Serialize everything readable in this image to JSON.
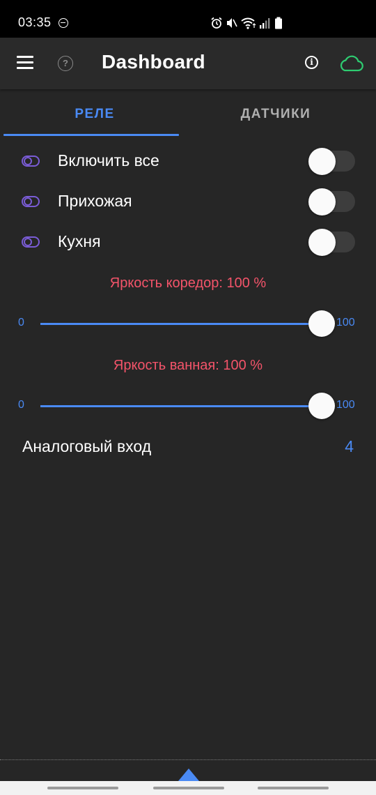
{
  "status_bar": {
    "time": "03:35",
    "icons": [
      "dnd-icon",
      "alarm-icon",
      "mute-icon",
      "wifi-icon",
      "signal-icon",
      "battery-icon"
    ]
  },
  "app_bar": {
    "title": "Dashboard",
    "icons": [
      "menu-icon",
      "help-icon",
      "info-icon",
      "cloud-icon"
    ],
    "help_glyph": "?",
    "info_glyph": "i",
    "cloud_color": "#2ecc71"
  },
  "tabs": [
    {
      "label": "РЕЛЕ",
      "active": true
    },
    {
      "label": "ДАТЧИКИ",
      "active": false
    }
  ],
  "relays": [
    {
      "label": "Включить все",
      "on": false
    },
    {
      "label": "Прихожая",
      "on": false
    },
    {
      "label": "Кухня",
      "on": false
    }
  ],
  "sliders": [
    {
      "title": "Яркость коредор: 100 %",
      "min": "0",
      "max": "100",
      "value": 100
    },
    {
      "title": "Яркость ванная: 100 %",
      "min": "0",
      "max": "100",
      "value": 100
    }
  ],
  "analog": {
    "label": "Аналоговый вход",
    "value": "4"
  },
  "colors": {
    "accent": "#4a8af4",
    "slider_title": "#f4546a",
    "relay_icon": "#7a5cd6",
    "background": "#262626"
  }
}
